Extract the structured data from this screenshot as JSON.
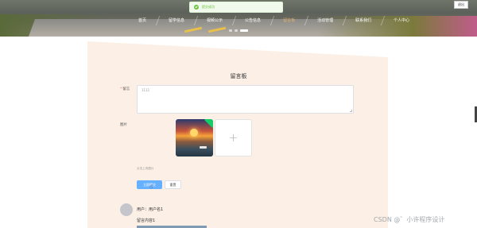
{
  "nav": {
    "items": [
      "首页",
      "留学信息",
      "视频公示",
      "公告信息",
      "留言板",
      "活动管理",
      "联系我们",
      "个人中心"
    ],
    "active_index": 4
  },
  "toast": {
    "text": "提交成功"
  },
  "header": {
    "logout_label": "退出"
  },
  "carousel": {
    "slide_count": 3,
    "active_index": 2
  },
  "form": {
    "title": "留言板",
    "message_label": "留言",
    "message_value": "1111",
    "image_label": "图片",
    "upload_hint": "点击上传图片",
    "submit_label": "立即提交",
    "reset_label": "重置",
    "add_icon": "plus-icon"
  },
  "comment": {
    "user_line": "用户：用户名1",
    "content_label": "留言内容1"
  },
  "watermark": "CSDN @゛小许程序设计",
  "colors": {
    "primary": "#66b1ff",
    "success": "#67c23a",
    "panel_bg": "#fbefe6",
    "nav_active": "#e0b070"
  }
}
